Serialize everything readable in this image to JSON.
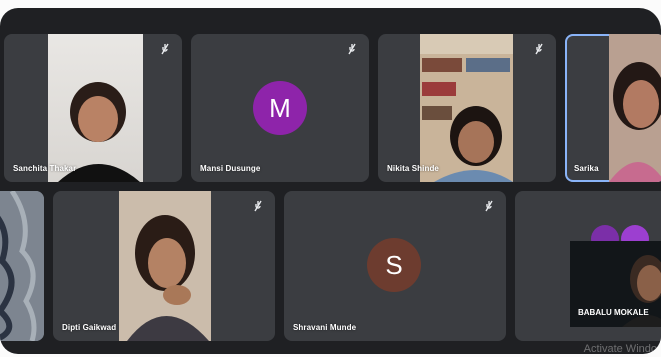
{
  "participants": {
    "row1": [
      {
        "name": "Sanchita Thakar"
      },
      {
        "name": "Mansi Dusunge",
        "avatar_letter": "M",
        "avatar_color": "#8e24aa"
      },
      {
        "name": "Nikita Shinde"
      },
      {
        "name": "Sarika"
      }
    ],
    "row2": [
      {
        "name": "Dipti Gaikwad"
      },
      {
        "name": "Shravani Munde",
        "avatar_letter": "S",
        "avatar_color": "#6d3c2f"
      },
      {
        "name": "BABALU MOKALE"
      }
    ]
  },
  "icons": {
    "mic": "mic-off-icon"
  },
  "colors": {
    "background": "#1f2023",
    "tile": "#3b3d41",
    "active_border": "#8ab4f8"
  },
  "watermark": "Activate Windo"
}
